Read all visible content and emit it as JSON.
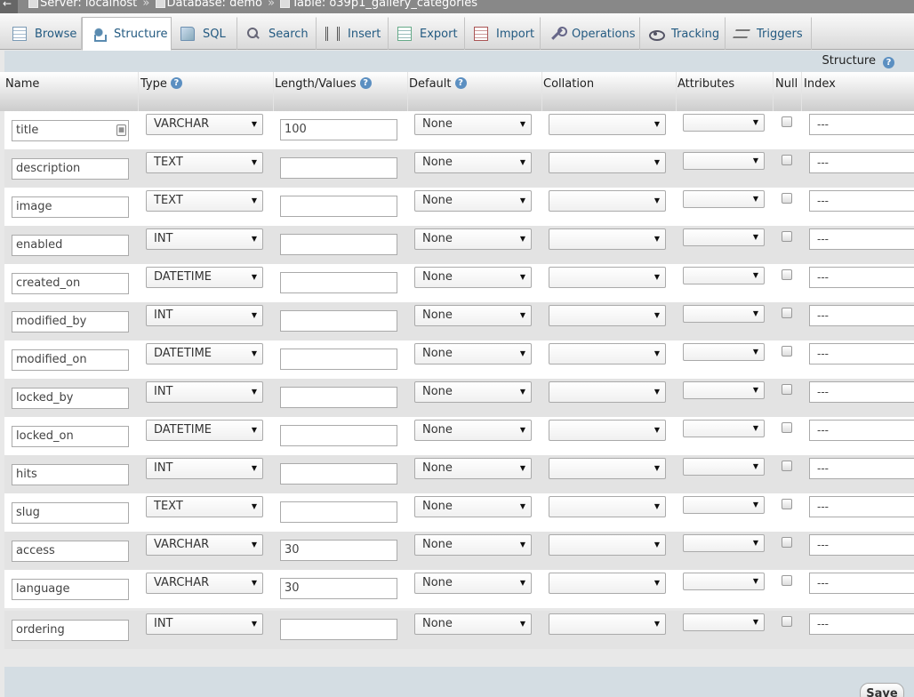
{
  "breadcrumb": {
    "server": "Server: localhost",
    "database": "Database: demo",
    "table": "Table: o39p1_gallery_categories",
    "separator": "»"
  },
  "tabs": [
    {
      "label": "Browse",
      "icon": "browse-icon"
    },
    {
      "label": "Structure",
      "icon": "structure-icon"
    },
    {
      "label": "SQL",
      "icon": "sql-icon"
    },
    {
      "label": "Search",
      "icon": "search-icon"
    },
    {
      "label": "Insert",
      "icon": "insert-icon"
    },
    {
      "label": "Export",
      "icon": "export-icon"
    },
    {
      "label": "Import",
      "icon": "import-icon"
    },
    {
      "label": "Operations",
      "icon": "operations-icon"
    },
    {
      "label": "Tracking",
      "icon": "tracking-icon"
    },
    {
      "label": "Triggers",
      "icon": "triggers-icon"
    }
  ],
  "active_tab": "Structure",
  "structure_label": "Structure",
  "columns": {
    "name": "Name",
    "type": "Type",
    "length": "Length/Values",
    "default": "Default",
    "collation": "Collation",
    "attributes": "Attributes",
    "null": "Null",
    "index": "Index"
  },
  "fields": [
    {
      "name": "title",
      "type": "VARCHAR",
      "length": "100",
      "default": "None",
      "index": "---"
    },
    {
      "name": "description",
      "type": "TEXT",
      "length": "",
      "default": "None",
      "index": "---"
    },
    {
      "name": "image",
      "type": "TEXT",
      "length": "",
      "default": "None",
      "index": "---"
    },
    {
      "name": "enabled",
      "type": "INT",
      "length": "",
      "default": "None",
      "index": "---"
    },
    {
      "name": "created_on",
      "type": "DATETIME",
      "length": "",
      "default": "None",
      "index": "---"
    },
    {
      "name": "modified_by",
      "type": "INT",
      "length": "",
      "default": "None",
      "index": "---"
    },
    {
      "name": "modified_on",
      "type": "DATETIME",
      "length": "",
      "default": "None",
      "index": "---"
    },
    {
      "name": "locked_by",
      "type": "INT",
      "length": "",
      "default": "None",
      "index": "---"
    },
    {
      "name": "locked_on",
      "type": "DATETIME",
      "length": "",
      "default": "None",
      "index": "---"
    },
    {
      "name": "hits",
      "type": "INT",
      "length": "",
      "default": "None",
      "index": "---"
    },
    {
      "name": "slug",
      "type": "TEXT",
      "length": "",
      "default": "None",
      "index": "---"
    },
    {
      "name": "access",
      "type": "VARCHAR",
      "length": "30",
      "default": "None",
      "index": "---"
    },
    {
      "name": "language",
      "type": "VARCHAR",
      "length": "30",
      "default": "None",
      "index": "---"
    },
    {
      "name": "ordering",
      "type": "INT",
      "length": "",
      "default": "None",
      "index": "---"
    }
  ],
  "save_label": "Save"
}
